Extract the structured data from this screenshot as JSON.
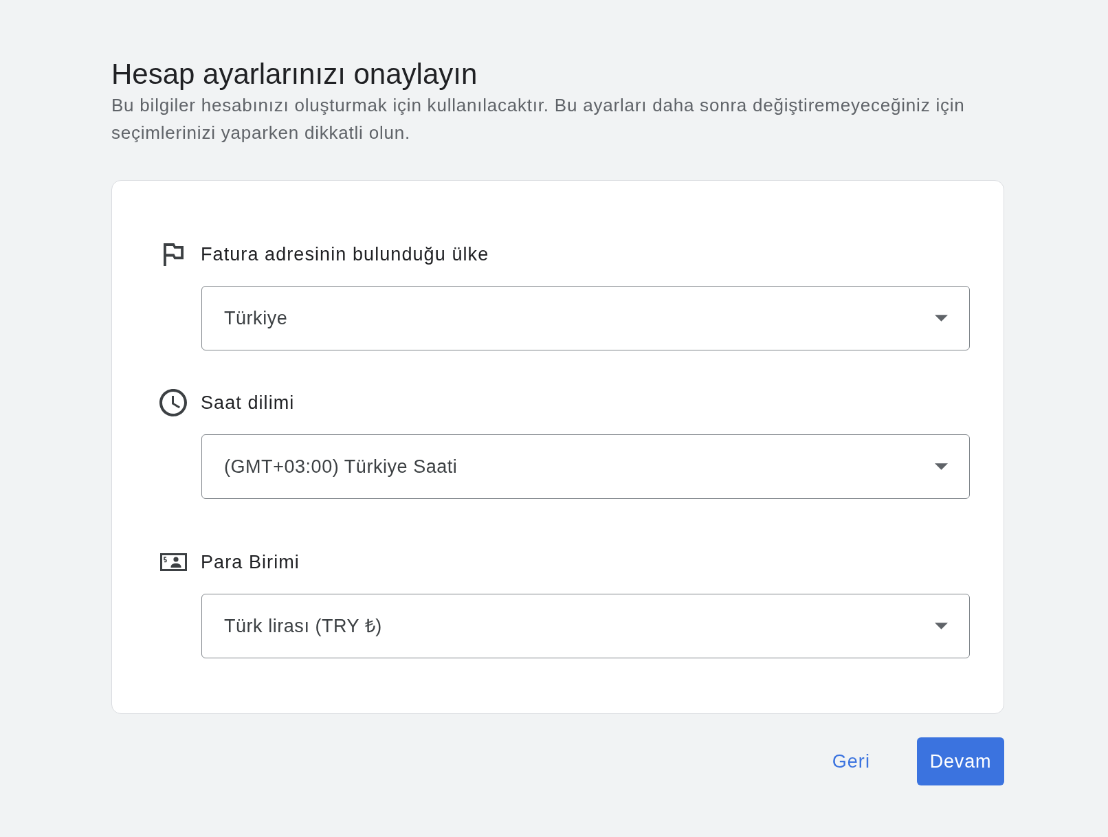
{
  "header": {
    "title": "Hesap ayarlarınızı onaylayın",
    "description": "Bu bilgiler hesabınızı oluşturmak için kullanılacaktır. Bu ayarları daha sonra değiştiremeyeceğiniz için seçimlerinizi yaparken dikkatli olun."
  },
  "settings": [
    {
      "kind": "country",
      "label": "Fatura adresinin bulunduğu ülke",
      "value": "Türkiye"
    },
    {
      "kind": "timezone",
      "label": "Saat dilimi",
      "value": "(GMT+03:00) Türkiye Saati"
    },
    {
      "kind": "currency",
      "label": "Para Birimi",
      "value": "Türk lirası (TRY ₺)"
    }
  ],
  "buttons": [
    {
      "kind": "text",
      "label": "Geri"
    },
    {
      "kind": "primary",
      "label": "Devam"
    }
  ]
}
